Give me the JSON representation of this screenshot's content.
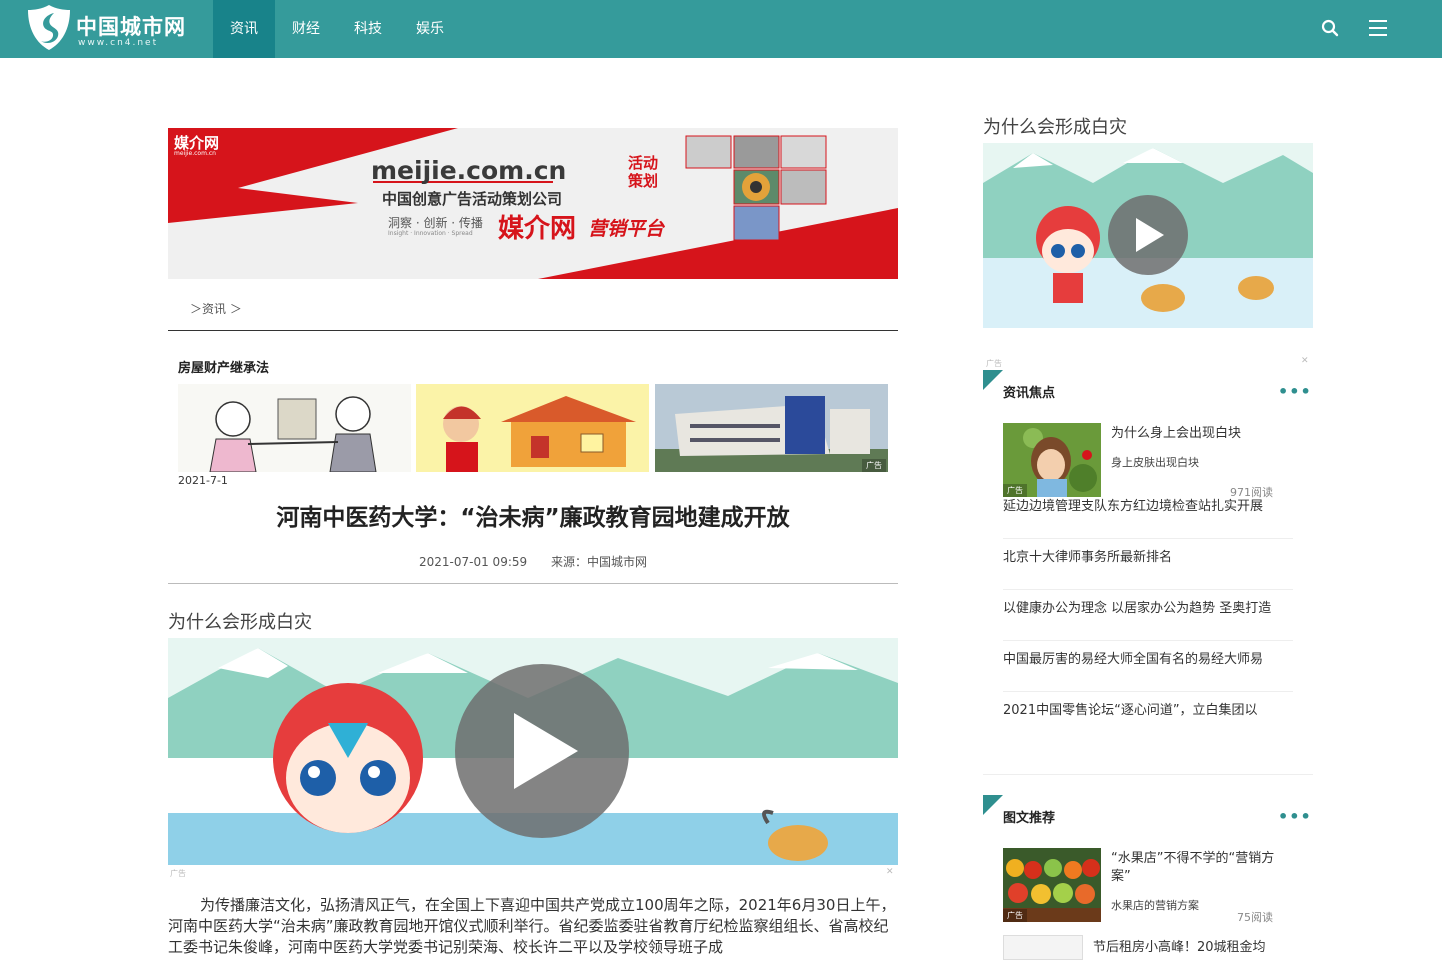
{
  "header": {
    "logo_text": "中国城市网",
    "logo_sub": "www.cn4.net",
    "nav": [
      {
        "label": "资讯",
        "active": true
      },
      {
        "label": "财经",
        "active": false
      },
      {
        "label": "科技",
        "active": false
      },
      {
        "label": "娱乐",
        "active": false
      }
    ],
    "search_icon": "search-icon",
    "menu_icon": "hamburger-menu-icon"
  },
  "banner": {
    "brand": "媒介网",
    "brand_sub": "meijie.com.cn",
    "domain": "meijie.com.cn",
    "company": "中国创意广告活动策划公司",
    "slogan": "洞察 · 创新 · 传播",
    "slogan_en": "Insight · Innovation · Spread",
    "platform_a": "媒介网",
    "platform_b": "营销平台",
    "activity": "活动",
    "planning": "策划"
  },
  "breadcrumb": "＞资讯 ＞",
  "related": {
    "title": "房屋财产继承法",
    "date": "2021-7-1",
    "ad_label": "广告"
  },
  "article": {
    "title": "河南中医药大学：“治未病”廉政教育园地建成开放",
    "datetime": "2021-07-01 09:59",
    "source": "来源：中国城市网",
    "video_title": "为什么会形成白灾",
    "ad_label": "广告",
    "body": "为传播廉洁文化，弘扬清风正气，在全国上下喜迎中国共产党成立100周年之际，2021年6月30日上午，河南中医药大学“治未病”廉政教育园地开馆仪式顺利举行。省纪委监委驻省教育厅纪检监察组组长、省高校纪工委书记朱俊峰，河南中医药大学党委书记别荣海、校长许二平以及学校领导班子成"
  },
  "sidebar": {
    "video_title": "为什么会形成白灾",
    "ad_label": "广告",
    "focus": {
      "title": "资讯焦点",
      "more": "•••",
      "feature": {
        "title": "为什么身上会出现白块",
        "subtitle": "身上皮肤出现白块",
        "reads": "971阅读"
      },
      "items": [
        "延边边境管理支队东方红边境检查站扎实开展",
        "北京十大律师事务所最新排名",
        "以健康办公为理念 以居家办公为趋势 圣奥打造",
        "中国最厉害的易经大师全国有名的易经大师易",
        "2021中国零售论坛“逐心问道”，立白集团以"
      ]
    },
    "recommend": {
      "title": "图文推荐",
      "more": "•••",
      "feature": {
        "title": "“水果店”不得不学的“营销方案”",
        "subtitle": "水果店的营销方案",
        "reads": "75阅读"
      },
      "next_title": "节后租房小高峰！20城租金均"
    }
  },
  "colors": {
    "header_bg": "#359b9b",
    "nav_active_bg": "#18838a",
    "accent": "#2f8f8f",
    "banner_red": "#d6141b"
  }
}
